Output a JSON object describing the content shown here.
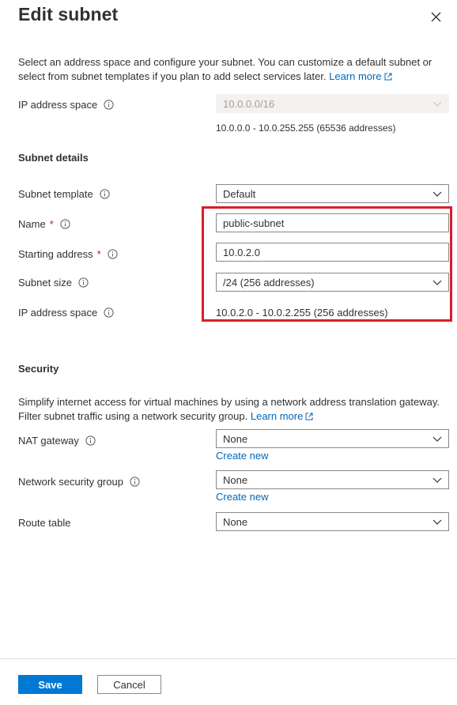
{
  "header": {
    "title": "Edit subnet"
  },
  "intro": {
    "text": "Select an address space and configure your subnet. You can customize a default subnet or select from subnet templates if you plan to add select services later.",
    "learn_more": "Learn more"
  },
  "address_space": {
    "label": "IP address space",
    "value": "10.0.0.0/16",
    "range": "10.0.0.0 - 10.0.255.255 (65536 addresses)"
  },
  "subnet_details": {
    "title": "Subnet details",
    "template_label": "Subnet template",
    "template_value": "Default",
    "name_label": "Name",
    "name_required": "*",
    "name_value": "public-subnet",
    "start_label": "Starting address",
    "start_required": "*",
    "start_value": "10.0.2.0",
    "size_label": "Subnet size",
    "size_value": "/24 (256 addresses)",
    "ip_space_label": "IP address space",
    "ip_space_value": "10.0.2.0 - 10.0.2.255 (256 addresses)"
  },
  "security": {
    "title": "Security",
    "text": "Simplify internet access for virtual machines by using a network address translation gateway. Filter subnet traffic using a network security group.",
    "learn_more": "Learn more",
    "nat_label": "NAT gateway",
    "nat_value": "None",
    "nat_create": "Create new",
    "nsg_label": "Network security group",
    "nsg_value": "None",
    "nsg_create": "Create new",
    "route_label": "Route table",
    "route_value": "None"
  },
  "footer": {
    "save_label": "Save",
    "cancel_label": "Cancel"
  },
  "colors": {
    "accent": "#0078d4",
    "link": "#0067b8",
    "highlight": "#d81e2a"
  }
}
